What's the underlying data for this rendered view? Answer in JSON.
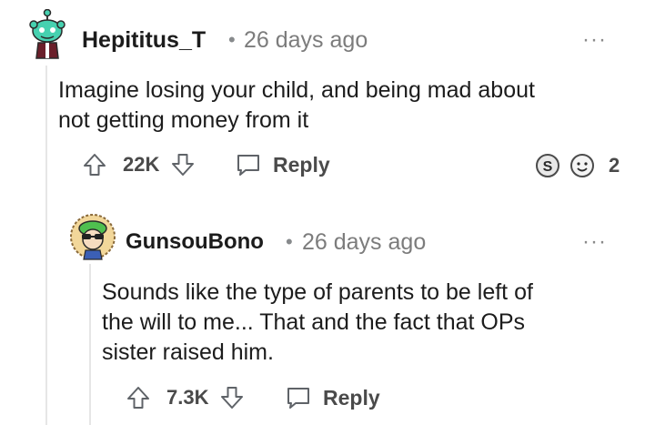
{
  "comments": [
    {
      "username": "Hepititus_T",
      "separator": "•",
      "time": "26 days ago",
      "menu": "···",
      "text_lines": [
        "Imagine losing your child, and being mad about",
        "not getting money from it"
      ],
      "votes": "22K",
      "reply_label": "Reply",
      "awards_count": "2"
    },
    {
      "username": "GunsouBono",
      "separator": "•",
      "time": "26 days ago",
      "menu": "···",
      "text_lines": [
        "Sounds like the type of parents to be left of",
        "the will to me... That and the fact that OPs",
        "sister raised him."
      ],
      "votes": "7.3K",
      "reply_label": "Reply"
    }
  ]
}
